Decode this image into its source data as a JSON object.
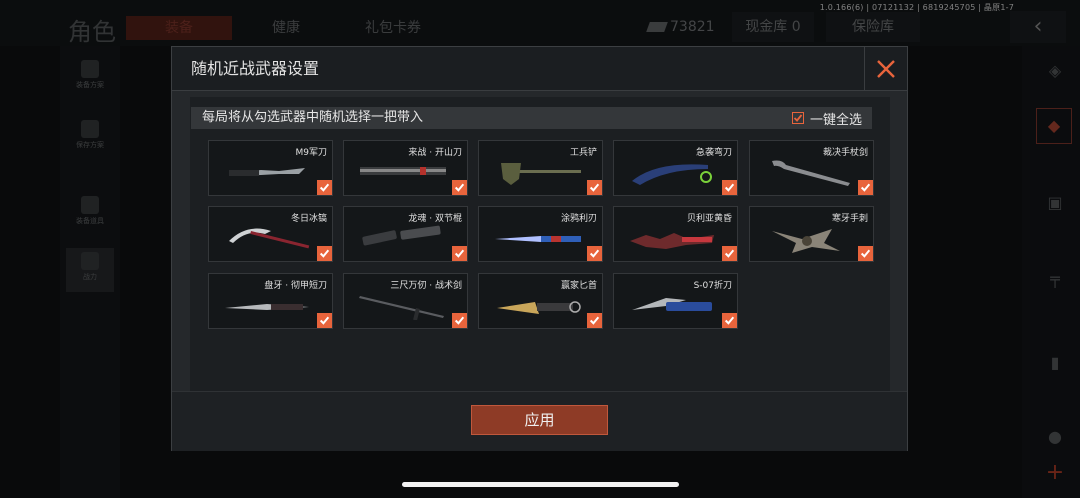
{
  "status": {
    "version": "1.0.166(6) | 07121132 | 6819245705 | 晶原1-7"
  },
  "background": {
    "title": "角色",
    "tabs": [
      "装备",
      "健康",
      "礼包卡券"
    ],
    "currency_value": "73821",
    "cash_vault": "现金库 0",
    "safe_box": "保险库",
    "left_items": [
      "装备方案",
      "保存方案",
      "装备道具",
      "战力"
    ]
  },
  "modal": {
    "title": "随机近战武器设置",
    "subheader": "每局将从勾选武器中随机选择一把带入",
    "select_all_label": "一键全选",
    "apply_label": "应用",
    "accent": "#e8643c",
    "weapons": [
      {
        "name": "M9军刀",
        "icon": "combat-knife",
        "checked": true
      },
      {
        "name": "来战 · 开山刀",
        "icon": "machete",
        "checked": true
      },
      {
        "name": "工兵铲",
        "icon": "shovel",
        "checked": true
      },
      {
        "name": "急袭弯刀",
        "icon": "curved-blade",
        "checked": true
      },
      {
        "name": "裁决手杖剑",
        "icon": "cane-sword",
        "checked": true
      },
      {
        "name": "冬日冰镐",
        "icon": "ice-axe",
        "checked": true
      },
      {
        "name": "龙魂 · 双节棍",
        "icon": "nunchaku",
        "checked": true
      },
      {
        "name": "涂鸦利刃",
        "icon": "graffiti-knife",
        "checked": true
      },
      {
        "name": "贝利亚黄昏",
        "icon": "jagged-blade",
        "checked": true
      },
      {
        "name": "寒牙手刺",
        "icon": "claw",
        "checked": true
      },
      {
        "name": "盘牙 · 彻甲短刀",
        "icon": "dagger",
        "checked": true
      },
      {
        "name": "三尺万仞 · 战术剑",
        "icon": "sword",
        "checked": true
      },
      {
        "name": "赢家匕首",
        "icon": "winner-dagger",
        "checked": true
      },
      {
        "name": "S-07折刀",
        "icon": "folding-knife",
        "checked": true
      }
    ]
  }
}
